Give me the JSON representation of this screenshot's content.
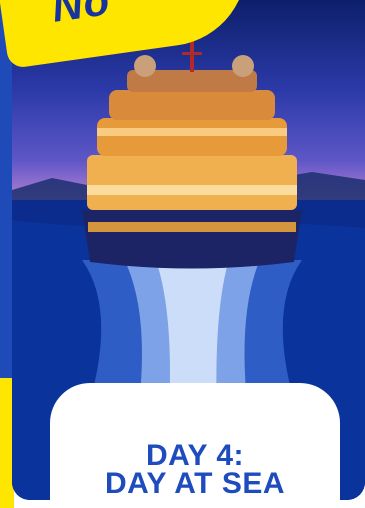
{
  "badge": {
    "text": "No"
  },
  "caption": {
    "line1": "DAY 4:",
    "line2": "DAY AT SEA"
  },
  "colors": {
    "brand_blue": "#1e4bbd",
    "brand_yellow": "#ffe600",
    "sea": "#0a2a86"
  },
  "icons": {
    "photo": "cruise-ship-image"
  }
}
